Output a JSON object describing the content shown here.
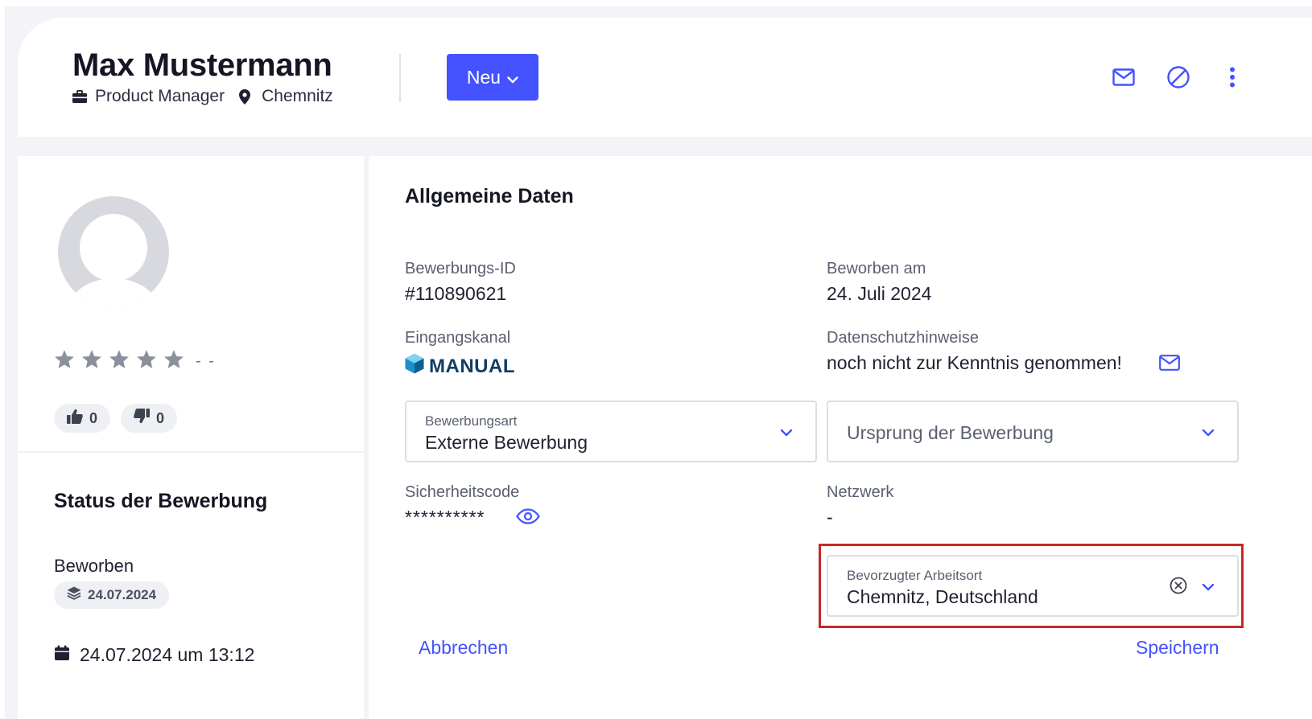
{
  "header": {
    "candidate_name": "Max Mustermann",
    "job_title": "Product Manager",
    "location": "Chemnitz",
    "new_button_label": "Neu",
    "icons": [
      "mail-icon",
      "block-icon",
      "more-vertical-icon"
    ]
  },
  "profile": {
    "rating_value": "- -",
    "stars": 5,
    "likes": "0",
    "dislikes": "0"
  },
  "status": {
    "title": "Status der Bewerbung",
    "stage": "Beworben",
    "stage_date": "24.07.2024",
    "timestamp": "24.07.2024 um 13:12"
  },
  "general": {
    "title": "Allgemeine Daten",
    "application_id_label": "Bewerbungs-ID",
    "application_id": "#110890621",
    "applied_on_label": "Beworben am",
    "applied_on": "24. Juli 2024",
    "channel_label": "Eingangskanal",
    "channel": "MANUAL",
    "privacy_label": "Datenschutzhinweise",
    "privacy_value": "noch nicht zur Kenntnis genommen!",
    "application_type_label": "Bewerbungsart",
    "application_type": "Externe Bewerbung",
    "origin_placeholder": "Ursprung der Bewerbung",
    "security_code_label": "Sicherheitscode",
    "security_code": "**********",
    "network_label": "Netzwerk",
    "network_value": "-",
    "preferred_location_label": "Bevorzugter Arbeitsort",
    "preferred_location": "Chemnitz, Deutschland",
    "cancel_label": "Abbrechen",
    "save_label": "Speichern"
  },
  "colors": {
    "accent": "#4452ff",
    "highlight": "#c62828",
    "manual_logo": "#0f3d63"
  }
}
